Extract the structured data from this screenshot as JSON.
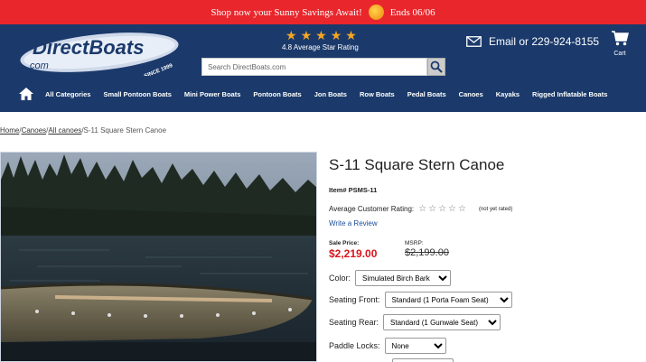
{
  "promo": {
    "text": "Shop now your Sunny Savings Await!",
    "ends": "Ends 06/06"
  },
  "header": {
    "logo_text": "DirectBoats",
    "logo_domain": ".com",
    "logo_since": "SINCE 1999",
    "rating_stars": 5,
    "rating_text": "4.8 Average Star Rating",
    "search_placeholder": "Search DirectBoats.com",
    "contact": "Email or 229-924-8155",
    "cart_label": "Cart",
    "brand_color": "#1b3a6b",
    "promo_color": "#e8262b"
  },
  "nav": {
    "items": [
      "All Categories",
      "Small Pontoon Boats",
      "Mini Power Boats",
      "Pontoon Boats",
      "Jon Boats",
      "Row Boats",
      "Pedal Boats",
      "Canoes",
      "Kayaks",
      "Rigged Inflatable Boats"
    ]
  },
  "breadcrumb": {
    "home": "Home",
    "canoes": "Canoes",
    "all_canoes": "All canoes",
    "current": "S-11 Square Stern Canoe"
  },
  "product": {
    "title": "S-11 Square Stern Canoe",
    "item_no": "Item# PSMS-11",
    "avg_rating_label": "Average Customer Rating:",
    "not_rated": "(not yet rated)",
    "write_review": "Write a Review",
    "sale_label": "Sale Price:",
    "sale_price": "$2,219.00",
    "msrp_label": "MSRP:",
    "msrp": "$2,199.00",
    "sale_color": "#d9141e"
  },
  "options": {
    "color_label": "Color:",
    "color_value": "Simulated Birch Bark",
    "seating_front_label": "Seating Front:",
    "seating_front_value": "Standard (1 Porta Foam Seat)",
    "seating_rear_label": "Seating Rear:",
    "seating_rear_value": "Standard (1 Gunwale Seat)",
    "paddle_locks_label": "Paddle Locks:",
    "paddle_locks_value": "None"
  }
}
